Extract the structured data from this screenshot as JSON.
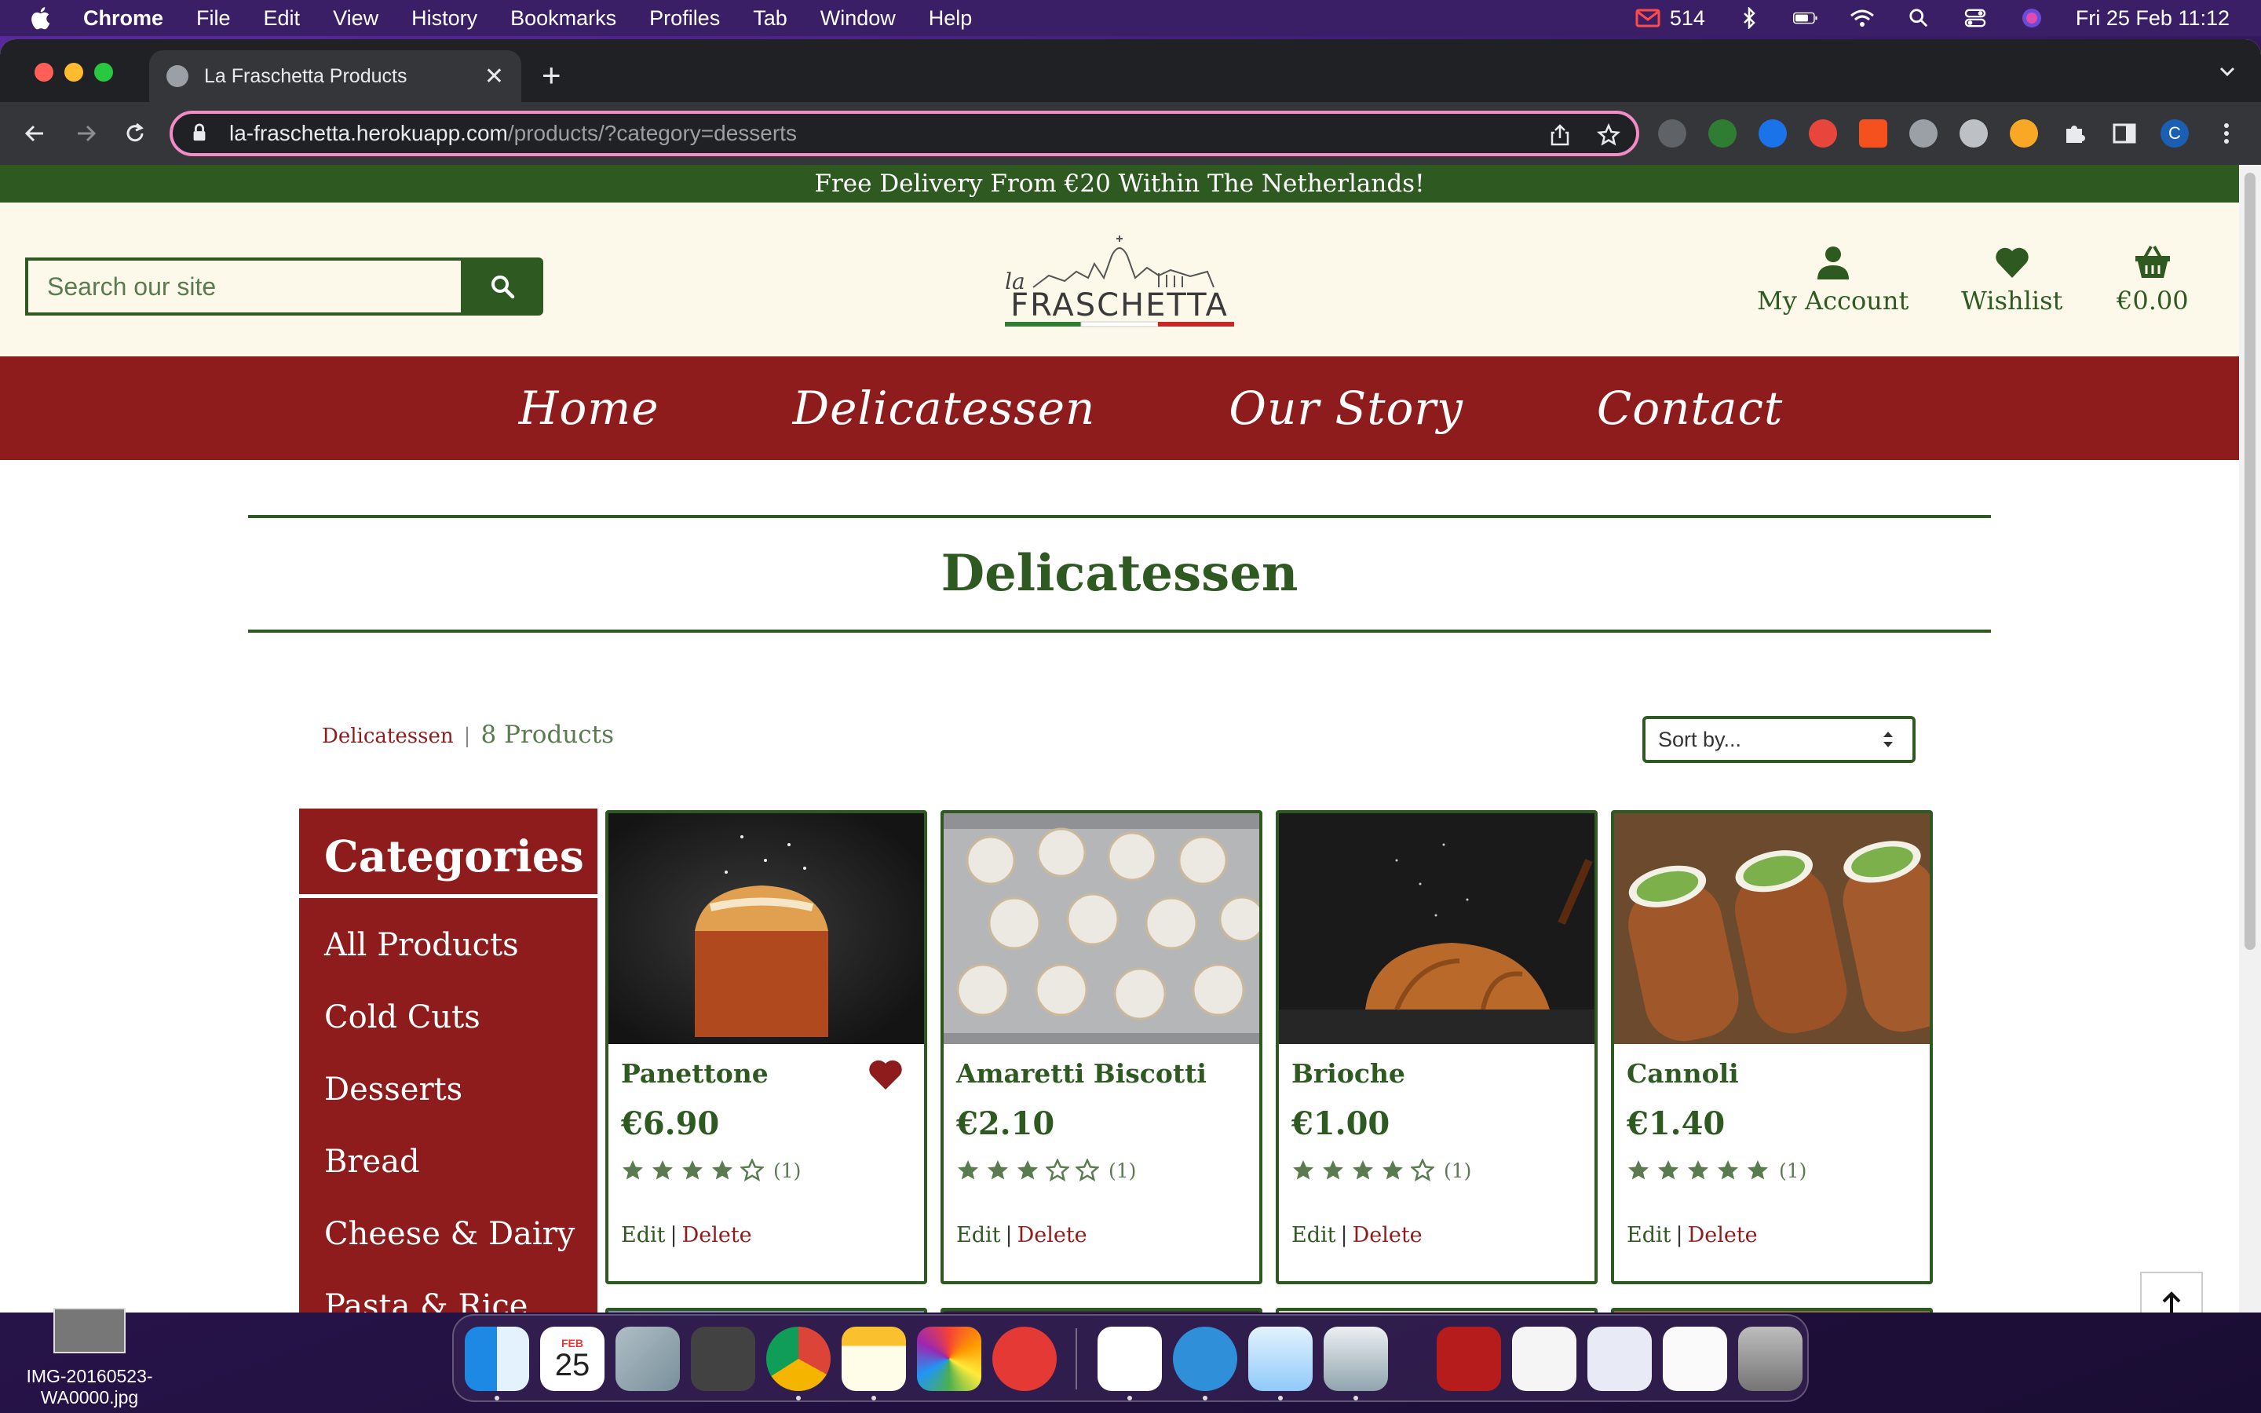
{
  "menubar": {
    "app": "Chrome",
    "items": [
      "File",
      "Edit",
      "View",
      "History",
      "Bookmarks",
      "Profiles",
      "Tab",
      "Window",
      "Help"
    ],
    "mail_count": "514",
    "datetime": "Fri 25 Feb  11:12"
  },
  "browser": {
    "tab_title": "La Fraschetta Products",
    "url_host": "la-fraschetta.herokuapp.com",
    "url_path": "/products/?category=desserts",
    "profile_initial": "C"
  },
  "site": {
    "promo": "Free Delivery From €20 Within The Netherlands!",
    "search_placeholder": "Search our site",
    "logo_small": "la",
    "logo_text": "FRASCHETTA",
    "account_label": "My Account",
    "wishlist_label": "Wishlist",
    "basket_total": "€0.00",
    "nav": [
      "Home",
      "Delicatessen",
      "Our Story",
      "Contact"
    ],
    "page_title": "Delicatessen",
    "breadcrumb_category": "Delicatessen",
    "breadcrumb_sep": "|",
    "product_count": "8 Products",
    "sort_label": "Sort by...",
    "categories_title": "Categories",
    "categories": [
      "All Products",
      "Cold Cuts",
      "Desserts",
      "Bread",
      "Cheese & Dairy",
      "Pasta & Rice"
    ],
    "edit_label": "Edit",
    "delete_label": "Delete",
    "products": [
      {
        "name": "Panettone",
        "price": "€6.90",
        "stars": 4,
        "rating_count": "(1)",
        "wishlisted": true
      },
      {
        "name": "Amaretti Biscotti",
        "price": "€2.10",
        "stars": 3,
        "rating_count": "(1)",
        "wishlisted": false
      },
      {
        "name": "Brioche",
        "price": "€1.00",
        "stars": 4,
        "rating_count": "(1)",
        "wishlisted": false
      },
      {
        "name": "Cannoli",
        "price": "€1.40",
        "stars": 5,
        "rating_count": "(1)",
        "wishlisted": false
      }
    ]
  },
  "desktop": {
    "file_name_line1": "IMG-20160523-",
    "file_name_line2": "WA0000.jpg",
    "calendar_month": "FEB",
    "calendar_day": "25"
  },
  "colors": {
    "brand_green": "#2e5a22",
    "brand_red": "#8e1c1c",
    "header_cream": "#fdf9ea"
  }
}
